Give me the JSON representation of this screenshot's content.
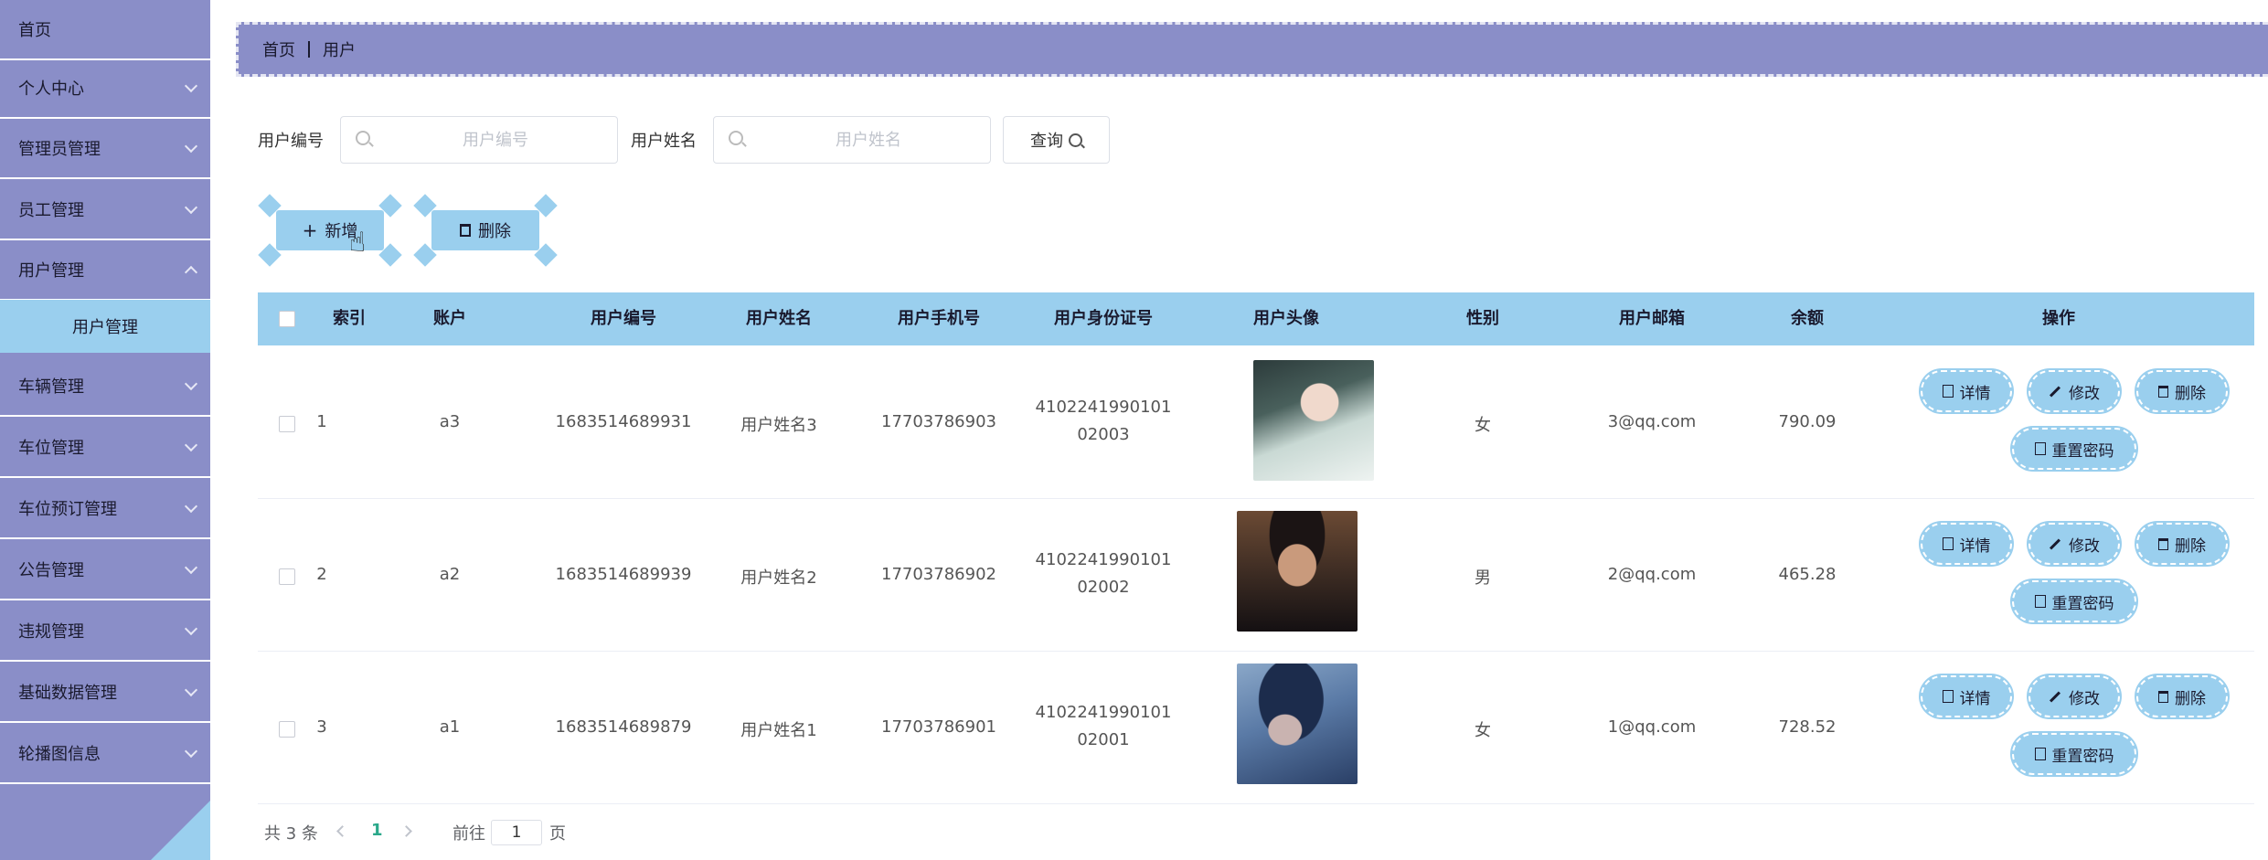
{
  "sidebar": {
    "items": [
      {
        "label": "首页",
        "has_arrow": false
      },
      {
        "label": "个人中心",
        "has_arrow": true
      },
      {
        "label": "管理员管理",
        "has_arrow": true
      },
      {
        "label": "员工管理",
        "has_arrow": true
      },
      {
        "label": "用户管理",
        "has_arrow": true,
        "open": true
      },
      {
        "label": "车辆管理",
        "has_arrow": true
      },
      {
        "label": "车位管理",
        "has_arrow": true
      },
      {
        "label": "车位预订管理",
        "has_arrow": true
      },
      {
        "label": "公告管理",
        "has_arrow": true
      },
      {
        "label": "违规管理",
        "has_arrow": true
      },
      {
        "label": "基础数据管理",
        "has_arrow": true
      },
      {
        "label": "轮播图信息",
        "has_arrow": true
      }
    ],
    "active_sub": "用户管理"
  },
  "breadcrumb": {
    "home": "首页",
    "current": "用户"
  },
  "search": {
    "field1_label": "用户编号",
    "field1_placeholder": "用户编号",
    "field2_label": "用户姓名",
    "field2_placeholder": "用户姓名",
    "query_label": "查询"
  },
  "actions": {
    "add_label": "新增",
    "delete_label": "删除"
  },
  "table": {
    "headers": [
      "索引",
      "账户",
      "用户编号",
      "用户姓名",
      "用户手机号",
      "用户身份证号",
      "用户头像",
      "性别",
      "用户邮箱",
      "余额",
      "操作"
    ],
    "rows": [
      {
        "index": "1",
        "account": "a3",
        "user_no": "1683514689931",
        "name": "用户姓名3",
        "phone": "17703786903",
        "id_line1": "4102241990101",
        "id_line2": "02003",
        "gender": "女",
        "email": "3@qq.com",
        "balance": "790.09"
      },
      {
        "index": "2",
        "account": "a2",
        "user_no": "1683514689939",
        "name": "用户姓名2",
        "phone": "17703786902",
        "id_line1": "4102241990101",
        "id_line2": "02002",
        "gender": "男",
        "email": "2@qq.com",
        "balance": "465.28"
      },
      {
        "index": "3",
        "account": "a1",
        "user_no": "1683514689879",
        "name": "用户姓名1",
        "phone": "17703786901",
        "id_line1": "4102241990101",
        "id_line2": "02001",
        "gender": "女",
        "email": "1@qq.com",
        "balance": "728.52"
      }
    ],
    "op_labels": {
      "detail": "详情",
      "edit": "修改",
      "delete": "删除",
      "reset": "重置密码"
    }
  },
  "pagination": {
    "total_text": "共 3 条",
    "current_page": "1",
    "goto_label": "前往",
    "goto_value": "1",
    "page_suffix": "页"
  },
  "colors": {
    "sidebar": "#8a8ec8",
    "accent": "#9acfee",
    "page_active": "#2aa88a"
  }
}
